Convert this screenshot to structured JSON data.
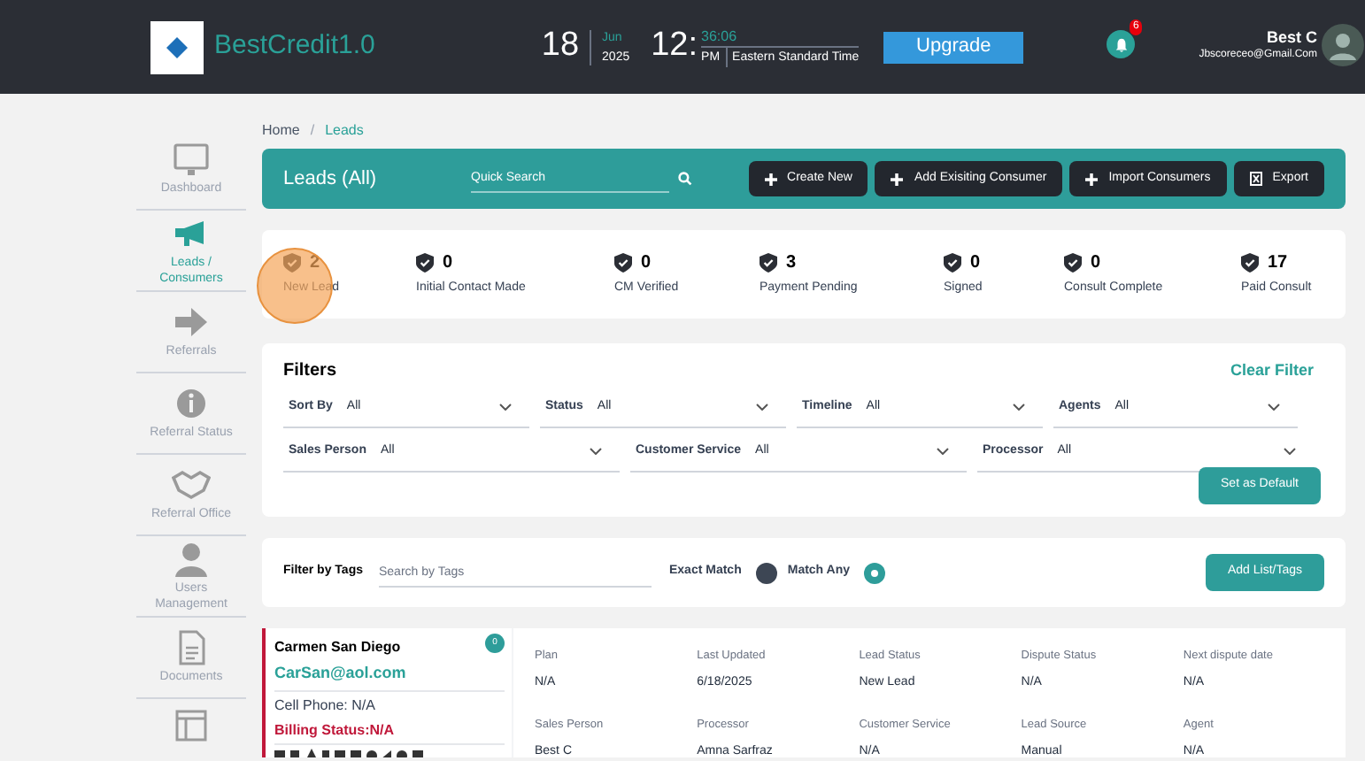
{
  "header": {
    "app_name": "BestCredit1.0",
    "date": {
      "day": "18",
      "month": "Jun",
      "year": "2025"
    },
    "time": {
      "hour": "12:",
      "minute": "36:06",
      "ampm": "PM",
      "timezone": "Eastern Standard Time"
    },
    "upgrade": "Upgrade",
    "notifications": "6",
    "user": {
      "name": "Best C",
      "email": "Jbscoreceo@Gmail.Com"
    }
  },
  "sidebar": {
    "items": [
      {
        "label": "Dashboard",
        "selected": false
      },
      {
        "label": "Leads / Consumers",
        "selected": true
      },
      {
        "label": "Referrals",
        "selected": false
      },
      {
        "label": "Referral Status",
        "selected": false
      },
      {
        "label": "Referral Office",
        "selected": false
      },
      {
        "label": "Users Management",
        "selected": false
      },
      {
        "label": "Documents",
        "selected": false
      }
    ]
  },
  "breadcrumb": [
    "Home",
    "Leads"
  ],
  "breadcrumb_separator": "/",
  "toolbar": {
    "title": "Leads (All)",
    "search_placeholder": "Quick Search",
    "buttons": [
      {
        "label": "Create New",
        "kind": "add"
      },
      {
        "label": "Add Exisiting Consumer",
        "kind": "add"
      },
      {
        "label": "Import Consumers",
        "kind": "add"
      },
      {
        "label": "Export",
        "kind": "export"
      }
    ]
  },
  "stats": [
    {
      "count": "2",
      "label": "New Lead"
    },
    {
      "count": "0",
      "label": "Initial Contact Made"
    },
    {
      "count": "0",
      "label": "CM Verified"
    },
    {
      "count": "3",
      "label": "Payment Pending"
    },
    {
      "count": "0",
      "label": "Signed"
    },
    {
      "count": "0",
      "label": "Consult Complete"
    },
    {
      "count": "17",
      "label": "Paid Consult"
    }
  ],
  "filters": {
    "title": "Filters",
    "clear": "Clear Filter",
    "rows": [
      [
        {
          "label": "Sort By",
          "value": "All"
        },
        {
          "label": "Status",
          "value": "All"
        },
        {
          "label": "Timeline",
          "value": "All"
        },
        {
          "label": "Agents",
          "value": "All"
        }
      ],
      [
        {
          "label": "Sales Person",
          "value": "All"
        },
        {
          "label": "Customer Service",
          "value": "All"
        },
        {
          "label": "Processor",
          "value": "All"
        }
      ]
    ],
    "set_default": "Set as Default"
  },
  "tags": {
    "label": "Filter by Tags",
    "placeholder": "Search by Tags",
    "options": [
      {
        "label": "Exact Match",
        "selected": false
      },
      {
        "label": "Match Any",
        "selected": true
      }
    ],
    "add_button": "Add List/Tags"
  },
  "lead": {
    "badge": "0",
    "name": "Carmen San Diego",
    "email": "CarSan@aol.com",
    "phone": "Cell Phone: N/A",
    "billing": "Billing Status:N/A",
    "fields": [
      {
        "label": "Plan",
        "value": "N/A"
      },
      {
        "label": "Last Updated",
        "value": "6/18/2025"
      },
      {
        "label": "Lead Status",
        "value": "New Lead"
      },
      {
        "label": "Dispute Status",
        "value": "N/A"
      },
      {
        "label": "Next dispute date",
        "value": "N/A"
      },
      {
        "label": "Sales Person",
        "value": "Best C"
      },
      {
        "label": "Processor",
        "value": "Amna Sarfraz"
      },
      {
        "label": "Customer Service",
        "value": "N/A"
      },
      {
        "label": "Lead Source",
        "value": "Manual"
      },
      {
        "label": "Agent",
        "value": "N/A"
      }
    ]
  }
}
